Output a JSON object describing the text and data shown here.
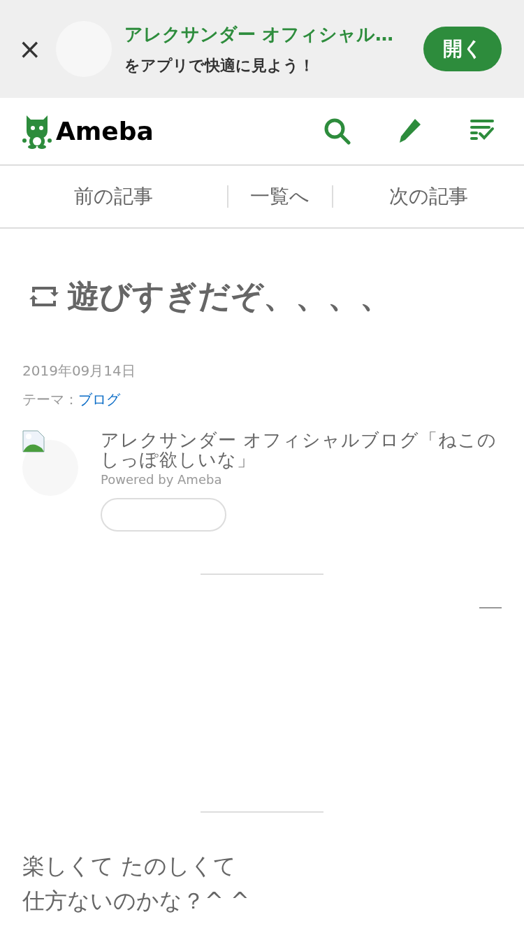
{
  "app_banner": {
    "close": "×",
    "title": "アレクサンダー オフィシャル…",
    "subtitle": "をアプリで快適に見よう！",
    "open_button": "開く"
  },
  "header": {
    "logo": "Ameba"
  },
  "article_nav": [
    {
      "label": "前の記事"
    },
    {
      "label": "一覧へ"
    },
    {
      "label": "次の記事"
    }
  ],
  "article": {
    "title": "遊びすぎだぞ、、、、",
    "date": "2019年09月14日",
    "theme_label": "テーマ：",
    "theme": "ブログ",
    "blog_name": "アレクサンダー オフィシャルブログ「ねこのしっぽ欲しいな」",
    "powered_by": "Powered by Ameba",
    "body": [
      "楽しくて たのしくて",
      "仕方ないのかな？^ ^"
    ]
  }
}
